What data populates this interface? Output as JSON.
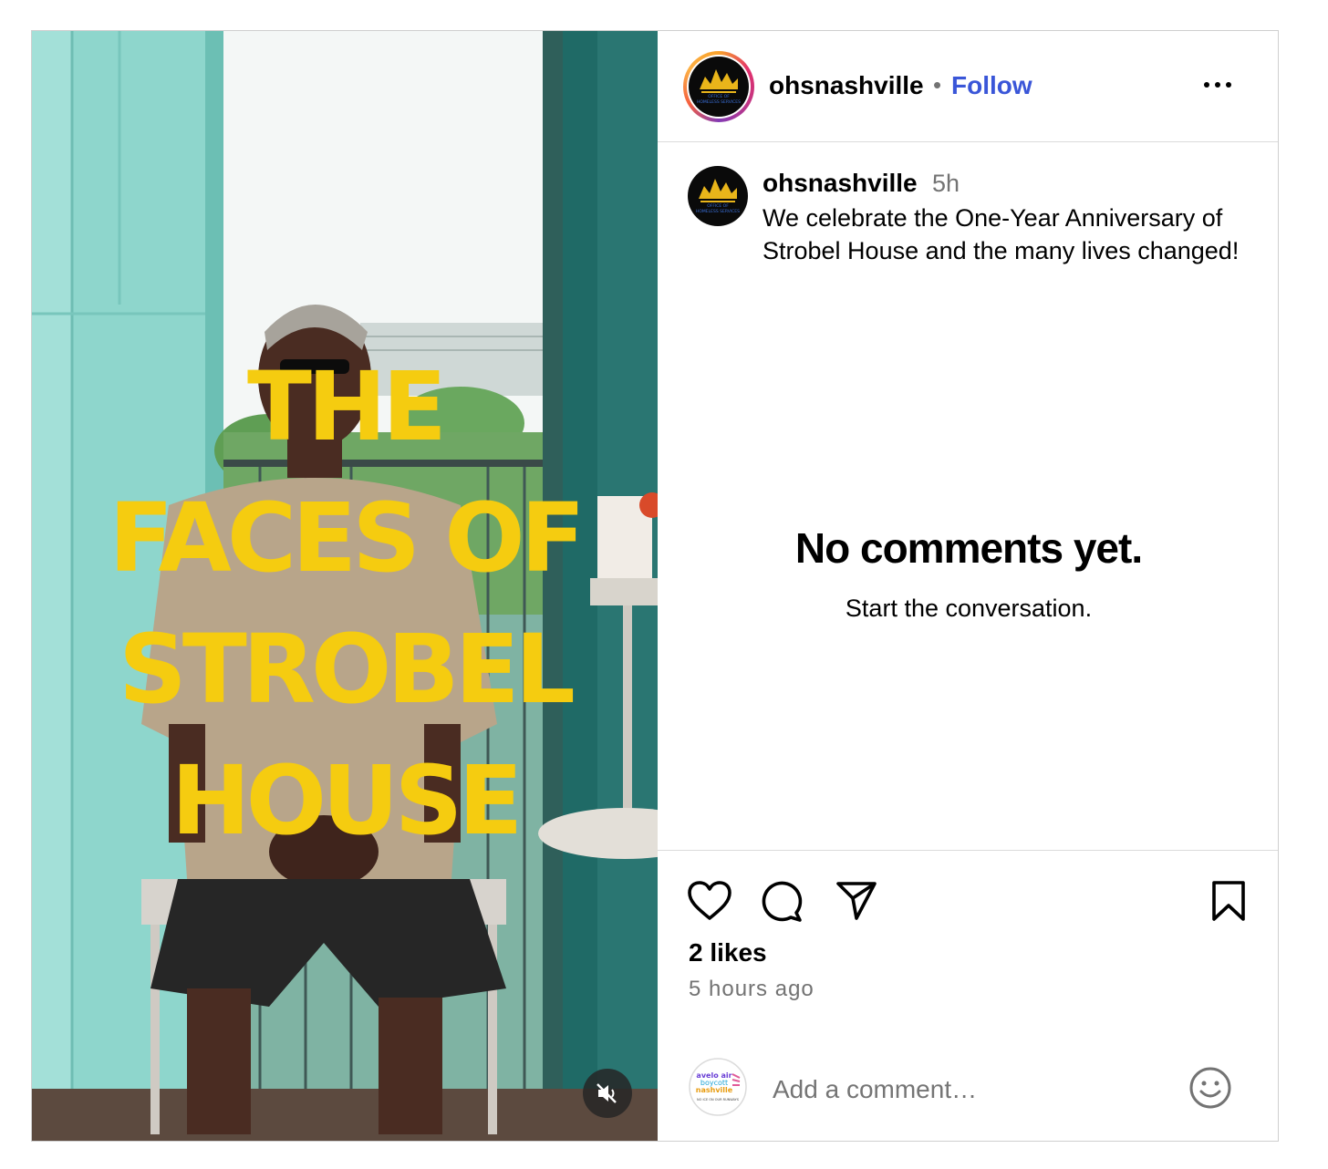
{
  "colors": {
    "follow": "#3a56d8",
    "overlay_text": "#f5cc10",
    "muted_text": "#737373"
  },
  "media": {
    "overlay_lines": [
      "THE",
      "FACES OF",
      "STROBEL",
      "HOUSE"
    ],
    "mute_icon": "speaker-muted-icon"
  },
  "header": {
    "username": "ohsnashville",
    "separator": "•",
    "follow_label": "Follow",
    "more_icon": "more-options-icon",
    "avatar_logo_text": [
      "OFFICE OF",
      "HOMELESS SERVICES"
    ]
  },
  "caption": {
    "username": "ohsnashville",
    "time": "5h",
    "text": "We celebrate the One-Year Anniversary of Strobel House and the many lives changed!"
  },
  "comments": {
    "empty_title": "No comments yet.",
    "empty_subtitle": "Start the conversation."
  },
  "actions": {
    "icons": [
      "heart-icon",
      "comment-icon",
      "share-icon",
      "bookmark-icon"
    ],
    "likes": "2 likes",
    "time_ago": "5 hours ago"
  },
  "add_comment": {
    "placeholder": "Add a comment…",
    "avatar_text": [
      "avelo air",
      "boycott",
      "nashville",
      "NO ICE ON OUR RUNWAYS"
    ],
    "emoji_icon": "emoji-icon"
  }
}
